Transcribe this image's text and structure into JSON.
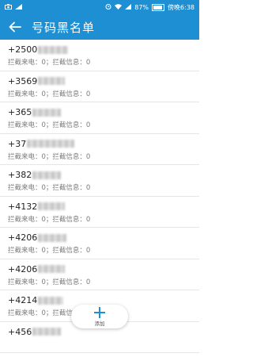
{
  "status": {
    "left_icons": [
      "camera-icon",
      "signal-icon"
    ],
    "right_icons": [
      "alarm-icon",
      "wifi-icon",
      "cellular-icon"
    ],
    "battery": "87%",
    "time": "傍晚6:38"
  },
  "header": {
    "title": "号码黑名单"
  },
  "entries": [
    {
      "number": "+2500",
      "detail": "拦截来电：0；拦截信息：0"
    },
    {
      "number": "+3569",
      "detail": "拦截来电：0；拦截信息：0"
    },
    {
      "number": "+365",
      "detail": "拦截来电：0；拦截信息：0"
    },
    {
      "number": "+37",
      "detail": "拦截来电：0；拦截信息：0"
    },
    {
      "number": "+382",
      "detail": "拦截来电：0；拦截信息：0"
    },
    {
      "number": "+4132",
      "detail": "拦截来电：0；拦截信息：0"
    },
    {
      "number": "+4206",
      "detail": "拦截来电：0；拦截信息：0"
    },
    {
      "number": "+4206",
      "detail": "拦截来电：0；拦截信息：0"
    },
    {
      "number": "+4214",
      "detail": "拦截来电：0；拦截信息：0"
    },
    {
      "number": "+456",
      "detail": ""
    }
  ],
  "fab": {
    "label": "添加"
  },
  "colors": {
    "accent": "#1f8fd3"
  }
}
